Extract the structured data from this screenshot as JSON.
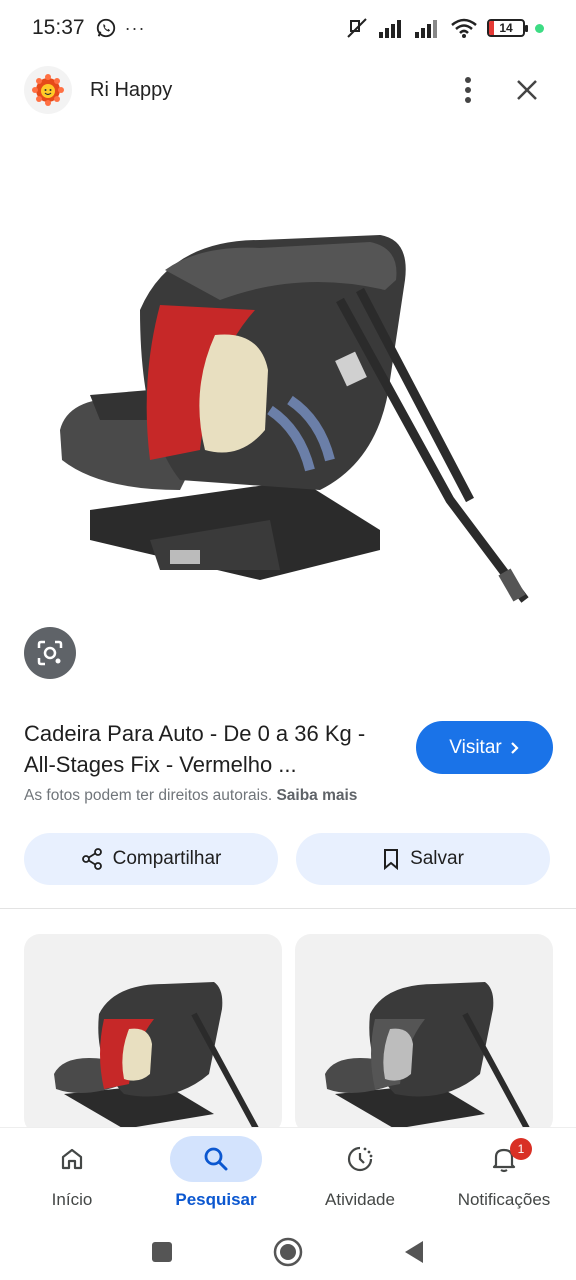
{
  "status_bar": {
    "time": "15:37",
    "battery_level": "14",
    "overflow": "···"
  },
  "header": {
    "site_name": "Ri Happy"
  },
  "product": {
    "title": "Cadeira Para Auto - De 0 a 36 Kg - All-Stages Fix - Vermelho ...",
    "copyright_text": "As fotos podem ter direitos autorais.",
    "learn_more": "Saiba mais",
    "visit_label": "Visitar"
  },
  "actions": {
    "share_label": "Compartilhar",
    "save_label": "Salvar"
  },
  "bottom_nav": {
    "items": [
      {
        "label": "Início",
        "icon": "home-icon"
      },
      {
        "label": "Pesquisar",
        "icon": "search-icon"
      },
      {
        "label": "Atividade",
        "icon": "activity-icon"
      },
      {
        "label": "Notificações",
        "icon": "bell-icon"
      }
    ],
    "notification_count": "1"
  },
  "colors": {
    "accent": "#1a73e8",
    "active_nav": "#0b57d0",
    "seat_red": "#c62828",
    "badge": "#d93025"
  }
}
